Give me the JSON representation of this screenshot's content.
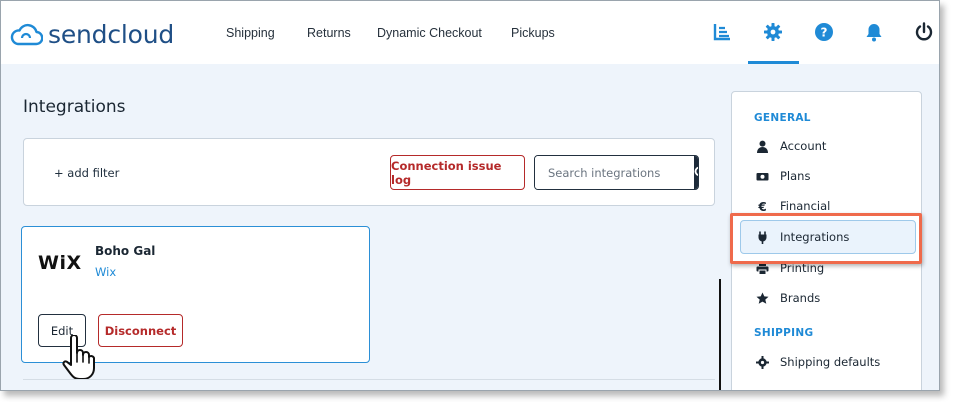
{
  "brand": {
    "name": "sendcloud",
    "color": "#1f4f86"
  },
  "nav": {
    "items": [
      {
        "label": "Shipping"
      },
      {
        "label": "Returns"
      },
      {
        "label": "Dynamic Checkout"
      },
      {
        "label": "Pickups"
      }
    ]
  },
  "top_icons": [
    "analytics-icon",
    "gear-icon",
    "help-icon",
    "bell-icon",
    "power-icon"
  ],
  "page": {
    "title": "Integrations"
  },
  "filters": {
    "add_filter_label": "+ add filter",
    "connection_log_label": "Connection issue log",
    "search_placeholder": "Search integrations"
  },
  "integration_card": {
    "logo_text": "WiX",
    "name": "Boho Gal",
    "platform": "Wix",
    "edit_label": "Edit",
    "disconnect_label": "Disconnect"
  },
  "sidebar": {
    "general_heading": "GENERAL",
    "items": [
      {
        "label": "Account",
        "icon": "user-icon"
      },
      {
        "label": "Plans",
        "icon": "money-icon"
      },
      {
        "label": "Financial",
        "icon": "euro-icon"
      },
      {
        "label": "Integrations",
        "icon": "plug-icon",
        "active": true
      },
      {
        "label": "Printing",
        "icon": "printer-icon"
      },
      {
        "label": "Brands",
        "icon": "star-icon"
      }
    ],
    "shipping_heading": "SHIPPING",
    "shipping_items": [
      {
        "label": "Shipping defaults",
        "icon": "gear-icon"
      }
    ]
  },
  "colors": {
    "accent": "#1f8ad6",
    "danger": "#b52a2a",
    "highlight": "#ef6a4b"
  }
}
